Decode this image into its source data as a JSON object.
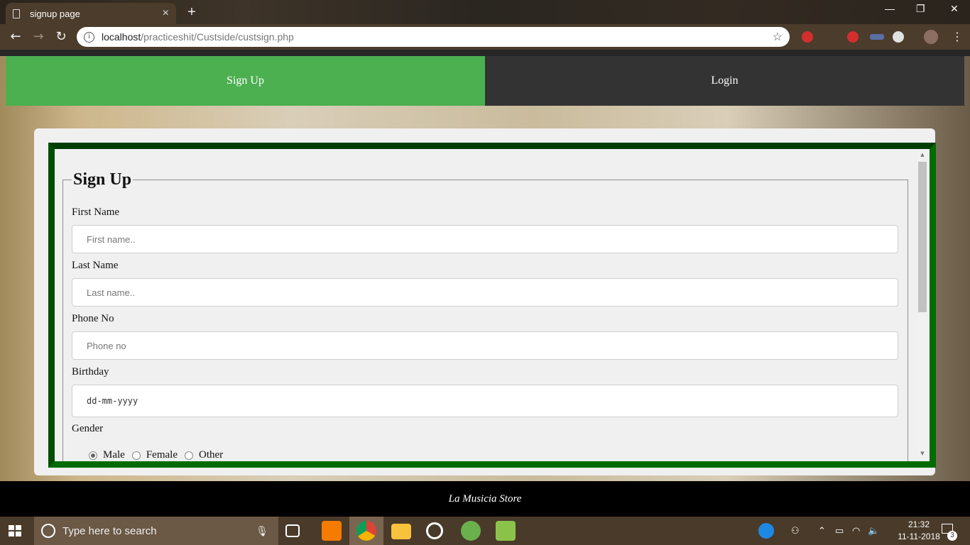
{
  "browser": {
    "tab_title": "signup page",
    "tab_close": "×",
    "new_tab": "+",
    "url_host": "localhost",
    "url_path": "/practiceshit/Custside/custsign.php",
    "window_controls": [
      "—",
      "❐",
      "✕"
    ]
  },
  "nav": {
    "signup_label": "Sign Up",
    "login_label": "Login",
    "active_color": "#4caf50",
    "inactive_color": "#333333"
  },
  "form": {
    "legend": "Sign Up",
    "first_name_label": "First Name",
    "first_name_placeholder": "First name..",
    "last_name_label": "Last Name",
    "last_name_placeholder": "Last name..",
    "phone_label": "Phone No",
    "phone_placeholder": "Phone no",
    "birthday_label": "Birthday",
    "birthday_placeholder": "dd-mm-yyyy",
    "gender_label": "Gender",
    "gender_options": [
      "Male",
      "Female",
      "Other"
    ],
    "gender_selected": "Male",
    "frame_color": "#006b00"
  },
  "footer": {
    "text": "La Musicia Store"
  },
  "taskbar": {
    "search_placeholder": "Type here to search",
    "time": "21:32",
    "date": "11-11-2018",
    "notification_count": "3"
  }
}
